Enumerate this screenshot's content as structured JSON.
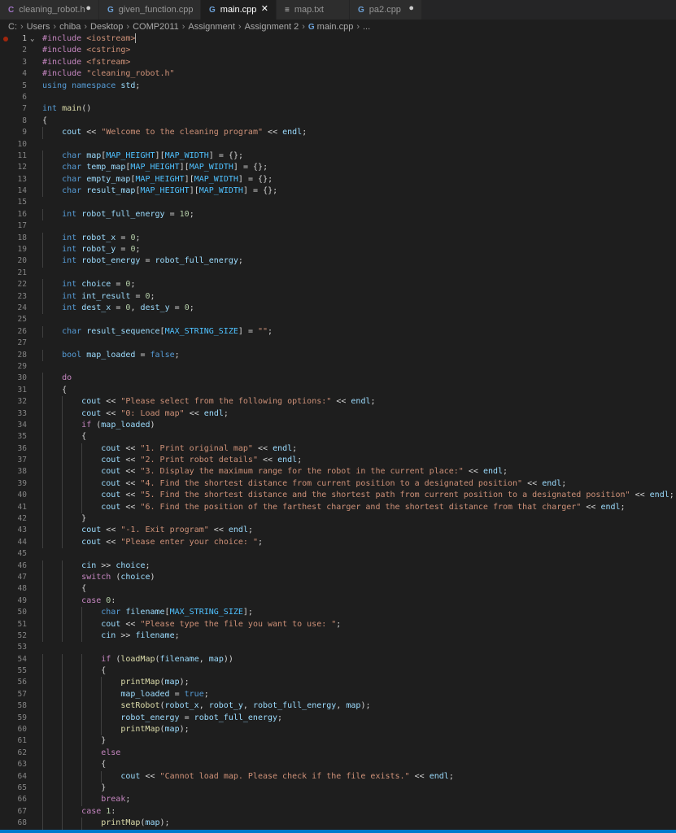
{
  "tabs": [
    {
      "name": "cleaning-robot-h",
      "label": "cleaning_robot.h",
      "icon": "C",
      "icon_color": "#a074c4",
      "state": "●",
      "active": false,
      "width": 122
    },
    {
      "name": "given-function-cpp",
      "label": "given_function.cpp",
      "icon": "G",
      "icon_color": "#6ca0d6",
      "state": "",
      "active": false,
      "width": 125
    },
    {
      "name": "main-cpp",
      "label": "main.cpp",
      "icon": "G",
      "icon_color": "#6ca0d6",
      "state": "✕",
      "active": true,
      "width": 93
    },
    {
      "name": "map-txt",
      "label": "map.txt",
      "icon": "≡",
      "icon_color": "#c5c5c5",
      "state": "",
      "active": false,
      "width": 90
    },
    {
      "name": "pa2-cpp",
      "label": "pa2.cpp",
      "icon": "G",
      "icon_color": "#6ca0d6",
      "state": "●",
      "active": false,
      "width": 89
    }
  ],
  "breadcrumb": [
    "C:",
    "Users",
    "chiba",
    "Desktop",
    "COMP2011",
    "Assignment",
    "Assignment 2",
    "main.cpp",
    "..."
  ],
  "colors": {
    "background": "#1e1e1e",
    "keyword": "#569cd6",
    "control": "#c586c0",
    "string": "#ce9178",
    "number": "#b5cea8",
    "function": "#dcdcaa",
    "variable": "#9cdcfe",
    "macro": "#4fc1ff",
    "status_bar": "#007acc"
  },
  "lines": [
    "#include <iostream>",
    "#include <cstring>",
    "#include <fstream>",
    "#include \"cleaning_robot.h\"",
    "using namespace std;",
    "",
    "int main()",
    "{",
    "    cout << \"Welcome to the cleaning program\" << endl;",
    "",
    "    char map[MAP_HEIGHT][MAP_WIDTH] = {};",
    "    char temp_map[MAP_HEIGHT][MAP_WIDTH] = {};",
    "    char empty_map[MAP_HEIGHT][MAP_WIDTH] = {};",
    "    char result_map[MAP_HEIGHT][MAP_WIDTH] = {};",
    "",
    "    int robot_full_energy = 10;",
    "",
    "    int robot_x = 0;",
    "    int robot_y = 0;",
    "    int robot_energy = robot_full_energy;",
    "",
    "    int choice = 0;",
    "    int int_result = 0;",
    "    int dest_x = 0, dest_y = 0;",
    "",
    "    char result_sequence[MAX_STRING_SIZE] = \"\";",
    "",
    "    bool map_loaded = false;",
    "",
    "    do",
    "    {",
    "        cout << \"Please select from the following options:\" << endl;",
    "        cout << \"0: Load map\" << endl;",
    "        if (map_loaded)",
    "        {",
    "            cout << \"1. Print original map\" << endl;",
    "            cout << \"2. Print robot details\" << endl;",
    "            cout << \"3. Display the maximum range for the robot in the current place:\" << endl;",
    "            cout << \"4. Find the shortest distance from current position to a designated position\" << endl;",
    "            cout << \"5. Find the shortest distance and the shortest path from current position to a designated position\" << endl;",
    "            cout << \"6. Find the position of the farthest charger and the shortest distance from that charger\" << endl;",
    "        }",
    "        cout << \"-1. Exit program\" << endl;",
    "        cout << \"Please enter your choice: \";",
    "",
    "        cin >> choice;",
    "        switch (choice)",
    "        {",
    "        case 0:",
    "            char filename[MAX_STRING_SIZE];",
    "            cout << \"Please type the file you want to use: \";",
    "            cin >> filename;",
    "",
    "            if (loadMap(filename, map))",
    "            {",
    "                printMap(map);",
    "                map_loaded = true;",
    "                setRobot(robot_x, robot_y, robot_full_energy, map);",
    "                robot_energy = robot_full_energy;",
    "                printMap(map);",
    "            }",
    "            else",
    "            {",
    "                cout << \"Cannot load map. Please check if the file exists.\" << endl;",
    "            }",
    "            break;",
    "        case 1:",
    "            printMap(map);"
  ]
}
